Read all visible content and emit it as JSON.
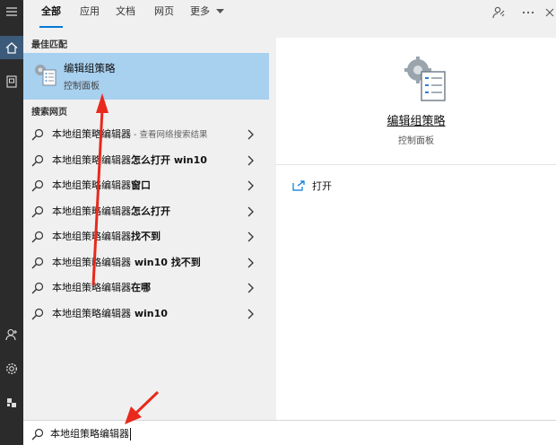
{
  "tabs": [
    {
      "label": "全部",
      "active": true
    },
    {
      "label": "应用",
      "active": false
    },
    {
      "label": "文档",
      "active": false
    },
    {
      "label": "网页",
      "active": false
    },
    {
      "label": "更多",
      "active": false
    }
  ],
  "best_match": {
    "heading": "最佳匹配",
    "title": "编辑组策略",
    "subtitle": "控制面板"
  },
  "web": {
    "heading": "搜索网页",
    "items": [
      {
        "prefix": "本地组策略编辑器",
        "bold": "",
        "note": " - 查看网络搜索结果"
      },
      {
        "prefix": "本地组策略编辑器",
        "bold": "怎么打开 win10",
        "note": ""
      },
      {
        "prefix": "本地组策略编辑器",
        "bold": "窗口",
        "note": ""
      },
      {
        "prefix": "本地组策略编辑器",
        "bold": "怎么打开",
        "note": ""
      },
      {
        "prefix": "本地组策略编辑器",
        "bold": "找不到",
        "note": ""
      },
      {
        "prefix": "本地组策略编辑器",
        "bold": " win10 找不到",
        "note": ""
      },
      {
        "prefix": "本地组策略编辑器",
        "bold": "在哪",
        "note": ""
      },
      {
        "prefix": "本地组策略编辑器",
        "bold": " win10",
        "note": ""
      }
    ]
  },
  "detail": {
    "title": "编辑组策略",
    "subtitle": "控制面板",
    "open_label": "打开"
  },
  "search": {
    "value": "本地组策略编辑器"
  },
  "colors": {
    "accent": "#0078d7",
    "highlight": "#a8d0ef",
    "annotation": "#e8291c"
  }
}
